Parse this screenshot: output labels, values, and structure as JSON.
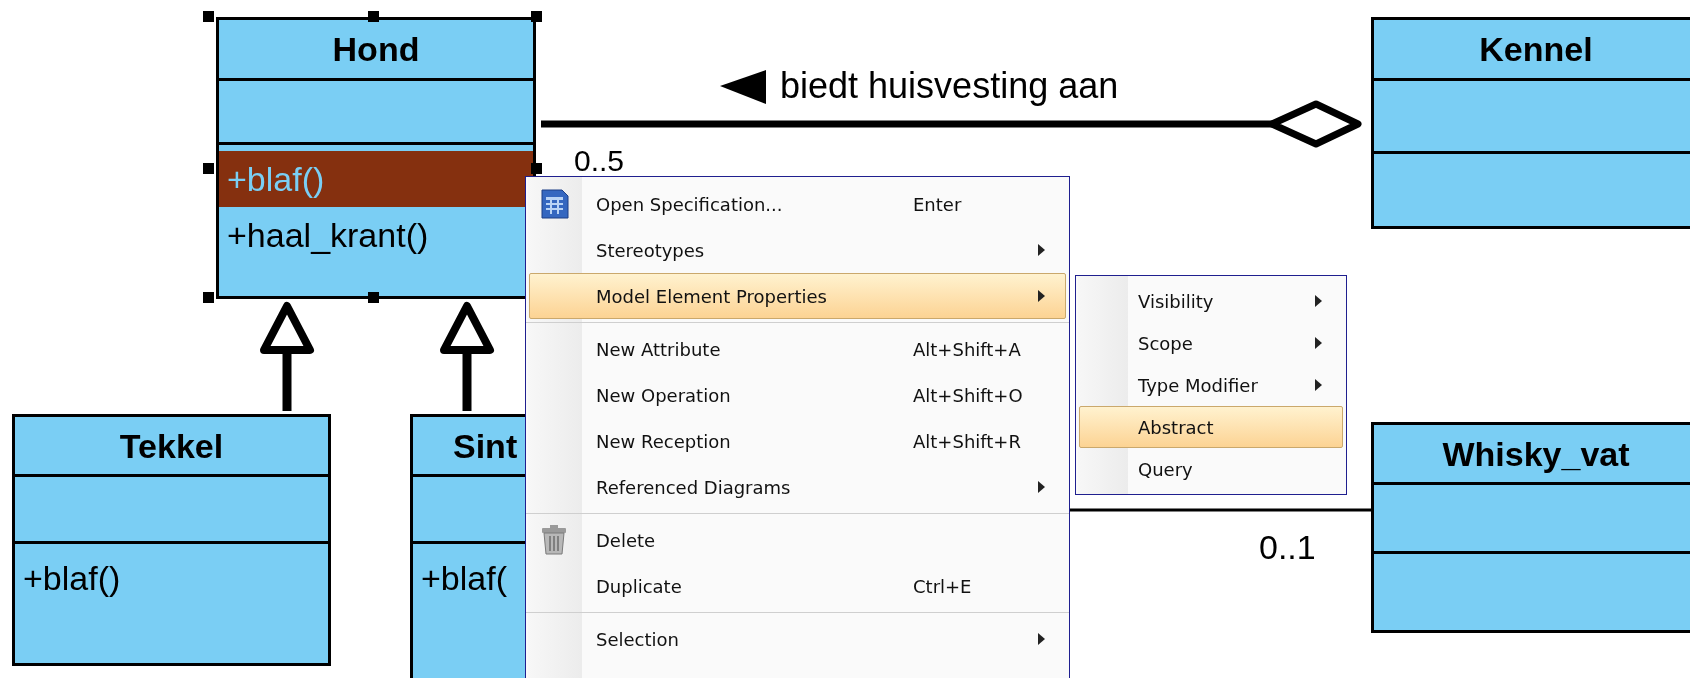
{
  "diagram": {
    "classes": [
      {
        "name": "Hond",
        "operations": [
          {
            "text": "+blaf()",
            "selected": true
          },
          {
            "text": "+haal_krant()",
            "selected": false
          }
        ]
      },
      {
        "name": "Kennel"
      },
      {
        "name": "Tekkel",
        "operations": [
          {
            "text": "+blaf()",
            "selected": false
          }
        ]
      },
      {
        "name": "Sint",
        "operations": [
          {
            "text": "+blaf(",
            "selected": false
          }
        ]
      },
      {
        "name": "Whisky_vat"
      }
    ],
    "associations": [
      {
        "label": "biedt huisvesting aan",
        "multiplicity": "0..5"
      },
      {
        "multiplicity": "0..1"
      }
    ]
  },
  "context_menu": {
    "groups": [
      [
        {
          "label": "Open Specification...",
          "shortcut": "Enter",
          "has_submenu": false,
          "highlighted": false
        },
        {
          "label": "Stereotypes",
          "has_submenu": true,
          "highlighted": false
        },
        {
          "label": "Model Element Properties",
          "has_submenu": true,
          "highlighted": true
        }
      ],
      [
        {
          "label": "New Attribute",
          "shortcut": "Alt+Shift+A",
          "has_submenu": false,
          "highlighted": false
        },
        {
          "label": "New Operation",
          "shortcut": "Alt+Shift+O",
          "has_submenu": false,
          "highlighted": false
        },
        {
          "label": "New Reception",
          "shortcut": "Alt+Shift+R",
          "has_submenu": false,
          "highlighted": false
        },
        {
          "label": "Referenced Diagrams",
          "has_submenu": true,
          "highlighted": false
        }
      ],
      [
        {
          "label": "Delete",
          "has_submenu": false,
          "highlighted": false
        },
        {
          "label": "Duplicate",
          "shortcut": "Ctrl+E",
          "has_submenu": false,
          "highlighted": false
        }
      ],
      [
        {
          "label": "Selection",
          "has_submenu": true,
          "highlighted": false
        }
      ]
    ]
  },
  "submenu": {
    "items": [
      {
        "label": "Visibility",
        "has_submenu": true,
        "highlighted": false
      },
      {
        "label": "Scope",
        "has_submenu": true,
        "highlighted": false
      },
      {
        "label": "Type Modifier",
        "has_submenu": true,
        "highlighted": false
      },
      {
        "label": "Abstract",
        "has_submenu": false,
        "highlighted": true
      },
      {
        "label": "Query",
        "has_submenu": false,
        "highlighted": false
      }
    ]
  }
}
